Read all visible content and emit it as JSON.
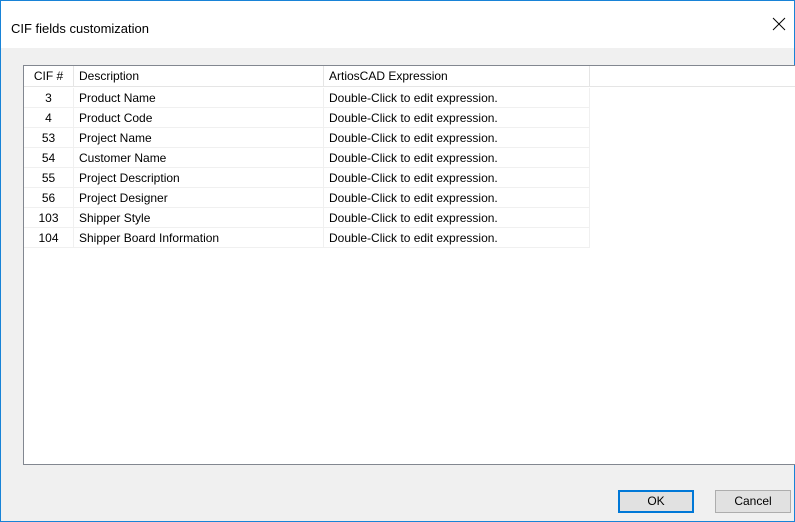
{
  "dialog": {
    "title": "CIF fields customization",
    "close_icon": "close-icon"
  },
  "table": {
    "columns": [
      "CIF #",
      "Description",
      "ArtiosCAD Expression"
    ],
    "rows": [
      {
        "cif": "3",
        "description": "Product Name",
        "expression": "Double-Click to edit expression."
      },
      {
        "cif": "4",
        "description": "Product Code",
        "expression": "Double-Click to edit expression."
      },
      {
        "cif": "53",
        "description": "Project Name",
        "expression": "Double-Click to edit expression."
      },
      {
        "cif": "54",
        "description": "Customer Name",
        "expression": "Double-Click to edit expression."
      },
      {
        "cif": "55",
        "description": "Project Description",
        "expression": "Double-Click to edit expression."
      },
      {
        "cif": "56",
        "description": "Project Designer",
        "expression": "Double-Click to edit expression."
      },
      {
        "cif": "103",
        "description": "Shipper Style",
        "expression": "Double-Click to edit expression."
      },
      {
        "cif": "104",
        "description": "Shipper Board Information",
        "expression": "Double-Click to edit expression."
      }
    ]
  },
  "buttons": {
    "ok": "OK",
    "cancel": "Cancel"
  },
  "colors": {
    "window_border": "#1883d7",
    "default_button_border": "#0078d7"
  }
}
